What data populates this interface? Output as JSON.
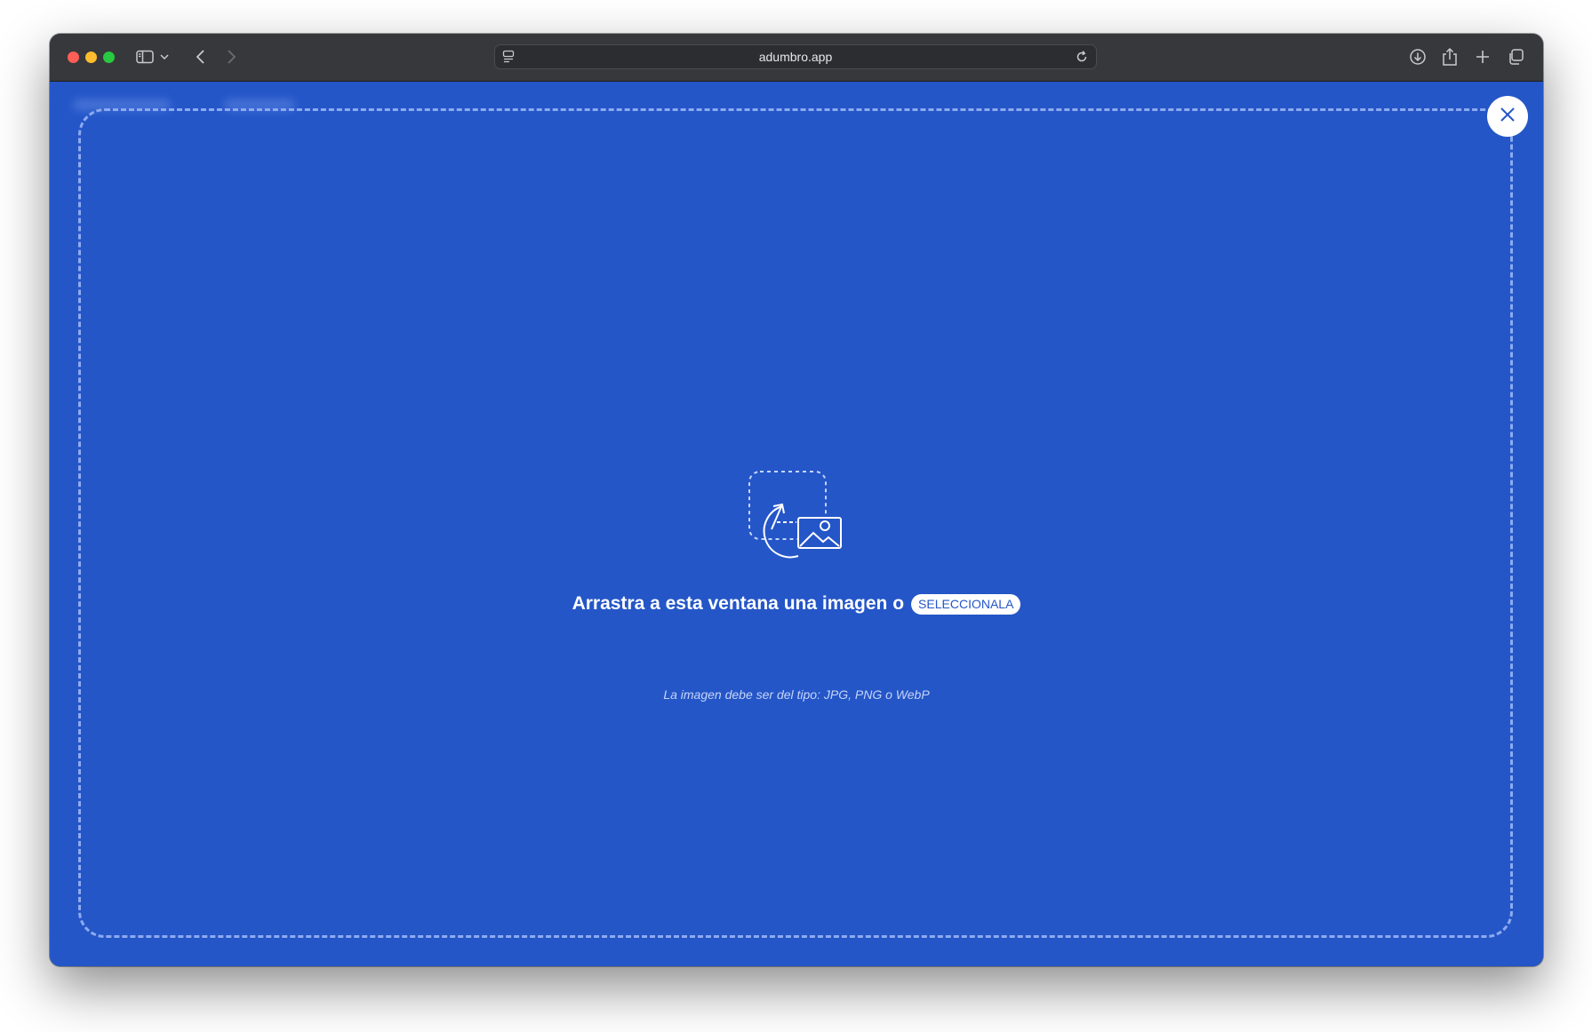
{
  "browser": {
    "url": "adumbro.app"
  },
  "dropzone": {
    "prompt": "Arrastra a esta ventana una imagen o",
    "select_label": "SELECCIONALA",
    "hint": "La imagen debe ser del tipo: JPG, PNG o WebP"
  },
  "colors": {
    "accent": "#2456c8",
    "toolbar": "#37383b",
    "dashed_border": "#8eaaf0"
  },
  "icons": {
    "close": "close-icon",
    "upload": "drag-image-icon"
  }
}
